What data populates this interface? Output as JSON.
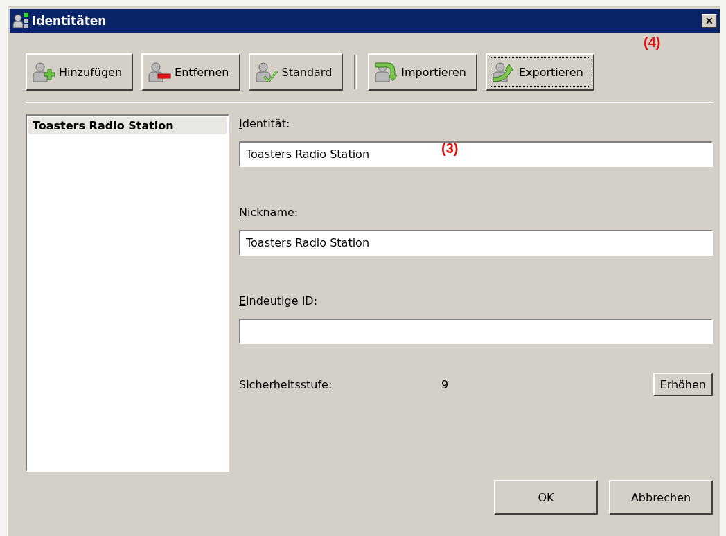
{
  "window": {
    "title": "Identitäten",
    "close": "✕"
  },
  "toolbar": [
    {
      "label": "Hinzufügen",
      "focused": false
    },
    {
      "label": "Entfernen",
      "focused": false
    },
    {
      "label": "Standard",
      "focused": false
    },
    {
      "label": "Importieren",
      "focused": false
    },
    {
      "label": "Exportieren",
      "focused": true
    }
  ],
  "identity_list": [
    {
      "label": "Toasters Radio Station",
      "selected": true
    }
  ],
  "fields": [
    {
      "label": "Identität:",
      "value": "Toasters Radio Station"
    },
    {
      "label": "Nickname:",
      "value": "Toasters Radio Station"
    },
    {
      "label": "Eindeutige ID:"
    }
  ],
  "security": {
    "label": "Sicherheitsstufe:",
    "value": "9",
    "button": "Erhöhen"
  },
  "buttons": [
    "OK",
    "Abbrechen"
  ],
  "annotations": [
    {
      "text": "(3)"
    },
    {
      "text": "(4)"
    }
  ]
}
